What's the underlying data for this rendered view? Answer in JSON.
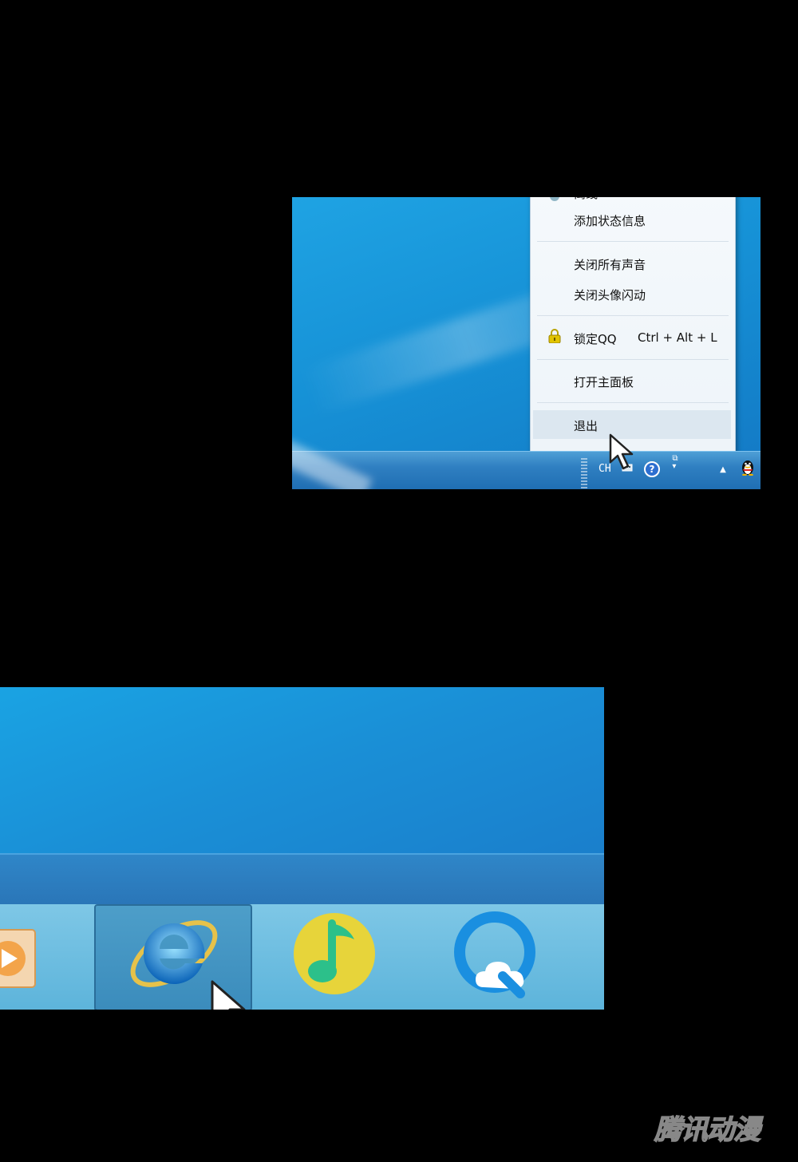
{
  "tray_menu": {
    "status_partial": "离线",
    "add_status_info": "添加状态信息",
    "mute_all_sounds": "关闭所有声音",
    "stop_avatar_flashing": "关闭头像闪动",
    "lock_qq": "锁定QQ",
    "lock_qq_shortcut": "Ctrl + Alt + L",
    "open_main_panel": "打开主面板",
    "exit": "退出"
  },
  "system_tray": {
    "input_language": "CH"
  },
  "taskbar": {
    "pinned_apps": [
      "media-player",
      "internet-explorer",
      "qq-music",
      "qq-cloud"
    ],
    "active_app": "internet-explorer"
  },
  "watermark": "腾讯动漫"
}
